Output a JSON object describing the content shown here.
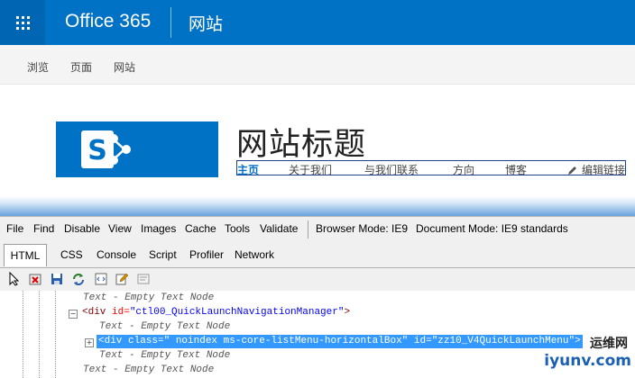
{
  "suite_bar": {
    "brand": "Office 365",
    "site_link": "网站"
  },
  "ribbon": {
    "tabs": [
      "浏览",
      "页面",
      "网站"
    ]
  },
  "site": {
    "title": "网站标题",
    "nav": [
      "主页",
      "关于我们",
      "与我们联系",
      "方向",
      "博客"
    ],
    "edit_links": "编辑链接"
  },
  "devtools": {
    "menu": [
      "File",
      "Find",
      "Disable",
      "View",
      "Images",
      "Cache",
      "Tools",
      "Validate"
    ],
    "browser_mode": "Browser Mode: IE9",
    "document_mode": "Document Mode: IE9 standards",
    "tabs": [
      "HTML",
      "CSS",
      "Console",
      "Script",
      "Profiler",
      "Network"
    ],
    "active_tab": "HTML",
    "tree": {
      "empty_text_node": "Text - Empty Text Node",
      "div_open": "<div",
      "id_attr": " id=",
      "class_attr": " class=",
      "close_bracket": ">",
      "nav_manager_id": "\"ctl00_QuickLaunchNavigationManager\"",
      "selected_class": "\" noindex ms-core-listMenu-horizontalBox\"",
      "selected_id": "\"zz10_V4QuickLaunchMenu\""
    }
  },
  "watermark": {
    "line1": "运维网",
    "line2": "iyunv.com"
  }
}
